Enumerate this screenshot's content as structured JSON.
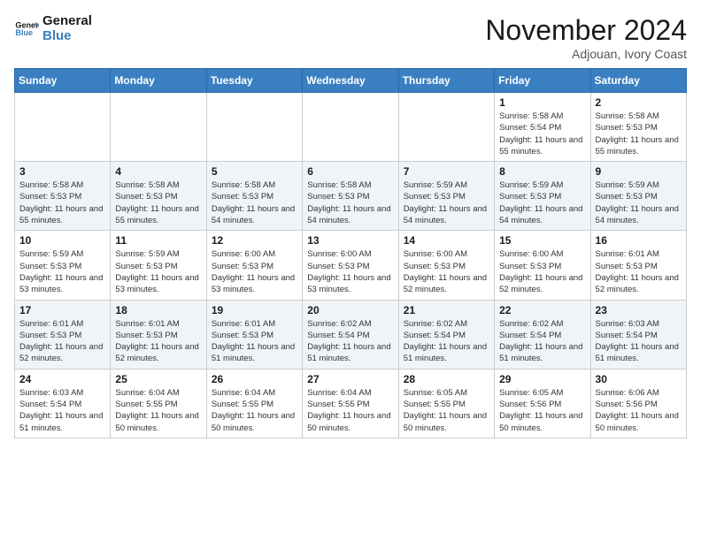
{
  "header": {
    "logo_line1": "General",
    "logo_line2": "Blue",
    "month": "November 2024",
    "location": "Adjouan, Ivory Coast"
  },
  "weekdays": [
    "Sunday",
    "Monday",
    "Tuesday",
    "Wednesday",
    "Thursday",
    "Friday",
    "Saturday"
  ],
  "weeks": [
    [
      {
        "day": "",
        "info": ""
      },
      {
        "day": "",
        "info": ""
      },
      {
        "day": "",
        "info": ""
      },
      {
        "day": "",
        "info": ""
      },
      {
        "day": "",
        "info": ""
      },
      {
        "day": "1",
        "info": "Sunrise: 5:58 AM\nSunset: 5:54 PM\nDaylight: 11 hours and 55 minutes."
      },
      {
        "day": "2",
        "info": "Sunrise: 5:58 AM\nSunset: 5:53 PM\nDaylight: 11 hours and 55 minutes."
      }
    ],
    [
      {
        "day": "3",
        "info": "Sunrise: 5:58 AM\nSunset: 5:53 PM\nDaylight: 11 hours and 55 minutes."
      },
      {
        "day": "4",
        "info": "Sunrise: 5:58 AM\nSunset: 5:53 PM\nDaylight: 11 hours and 55 minutes."
      },
      {
        "day": "5",
        "info": "Sunrise: 5:58 AM\nSunset: 5:53 PM\nDaylight: 11 hours and 54 minutes."
      },
      {
        "day": "6",
        "info": "Sunrise: 5:58 AM\nSunset: 5:53 PM\nDaylight: 11 hours and 54 minutes."
      },
      {
        "day": "7",
        "info": "Sunrise: 5:59 AM\nSunset: 5:53 PM\nDaylight: 11 hours and 54 minutes."
      },
      {
        "day": "8",
        "info": "Sunrise: 5:59 AM\nSunset: 5:53 PM\nDaylight: 11 hours and 54 minutes."
      },
      {
        "day": "9",
        "info": "Sunrise: 5:59 AM\nSunset: 5:53 PM\nDaylight: 11 hours and 54 minutes."
      }
    ],
    [
      {
        "day": "10",
        "info": "Sunrise: 5:59 AM\nSunset: 5:53 PM\nDaylight: 11 hours and 53 minutes."
      },
      {
        "day": "11",
        "info": "Sunrise: 5:59 AM\nSunset: 5:53 PM\nDaylight: 11 hours and 53 minutes."
      },
      {
        "day": "12",
        "info": "Sunrise: 6:00 AM\nSunset: 5:53 PM\nDaylight: 11 hours and 53 minutes."
      },
      {
        "day": "13",
        "info": "Sunrise: 6:00 AM\nSunset: 5:53 PM\nDaylight: 11 hours and 53 minutes."
      },
      {
        "day": "14",
        "info": "Sunrise: 6:00 AM\nSunset: 5:53 PM\nDaylight: 11 hours and 52 minutes."
      },
      {
        "day": "15",
        "info": "Sunrise: 6:00 AM\nSunset: 5:53 PM\nDaylight: 11 hours and 52 minutes."
      },
      {
        "day": "16",
        "info": "Sunrise: 6:01 AM\nSunset: 5:53 PM\nDaylight: 11 hours and 52 minutes."
      }
    ],
    [
      {
        "day": "17",
        "info": "Sunrise: 6:01 AM\nSunset: 5:53 PM\nDaylight: 11 hours and 52 minutes."
      },
      {
        "day": "18",
        "info": "Sunrise: 6:01 AM\nSunset: 5:53 PM\nDaylight: 11 hours and 52 minutes."
      },
      {
        "day": "19",
        "info": "Sunrise: 6:01 AM\nSunset: 5:53 PM\nDaylight: 11 hours and 51 minutes."
      },
      {
        "day": "20",
        "info": "Sunrise: 6:02 AM\nSunset: 5:54 PM\nDaylight: 11 hours and 51 minutes."
      },
      {
        "day": "21",
        "info": "Sunrise: 6:02 AM\nSunset: 5:54 PM\nDaylight: 11 hours and 51 minutes."
      },
      {
        "day": "22",
        "info": "Sunrise: 6:02 AM\nSunset: 5:54 PM\nDaylight: 11 hours and 51 minutes."
      },
      {
        "day": "23",
        "info": "Sunrise: 6:03 AM\nSunset: 5:54 PM\nDaylight: 11 hours and 51 minutes."
      }
    ],
    [
      {
        "day": "24",
        "info": "Sunrise: 6:03 AM\nSunset: 5:54 PM\nDaylight: 11 hours and 51 minutes."
      },
      {
        "day": "25",
        "info": "Sunrise: 6:04 AM\nSunset: 5:55 PM\nDaylight: 11 hours and 50 minutes."
      },
      {
        "day": "26",
        "info": "Sunrise: 6:04 AM\nSunset: 5:55 PM\nDaylight: 11 hours and 50 minutes."
      },
      {
        "day": "27",
        "info": "Sunrise: 6:04 AM\nSunset: 5:55 PM\nDaylight: 11 hours and 50 minutes."
      },
      {
        "day": "28",
        "info": "Sunrise: 6:05 AM\nSunset: 5:55 PM\nDaylight: 11 hours and 50 minutes."
      },
      {
        "day": "29",
        "info": "Sunrise: 6:05 AM\nSunset: 5:56 PM\nDaylight: 11 hours and 50 minutes."
      },
      {
        "day": "30",
        "info": "Sunrise: 6:06 AM\nSunset: 5:56 PM\nDaylight: 11 hours and 50 minutes."
      }
    ]
  ]
}
